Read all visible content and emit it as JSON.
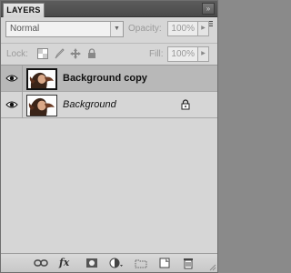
{
  "panel": {
    "tab_title": "LAYERS",
    "collapse_icon": "double-chevron-icon",
    "menu_icon": "panel-menu-icon"
  },
  "blend_mode": {
    "value": "Normal"
  },
  "opacity": {
    "label": "Opacity:",
    "value": "100%"
  },
  "lock": {
    "label": "Lock:"
  },
  "fill": {
    "label": "Fill:",
    "value": "100%"
  },
  "layers": [
    {
      "name": "Background copy",
      "visible": true,
      "selected": true,
      "locked": false
    },
    {
      "name": "Background",
      "visible": true,
      "selected": false,
      "locked": true
    }
  ],
  "bottom_toolbar": {
    "icons": [
      "link-layers-icon",
      "fx-icon",
      "add-mask-icon",
      "adjustment-layer-icon",
      "new-group-icon",
      "new-layer-icon",
      "delete-layer-icon"
    ],
    "fx_label": "fx"
  },
  "colors": {
    "panel_bg": "#d6d6d6",
    "selected_row": "#b8b8b8",
    "tab_bar": "#4f4f4f"
  }
}
